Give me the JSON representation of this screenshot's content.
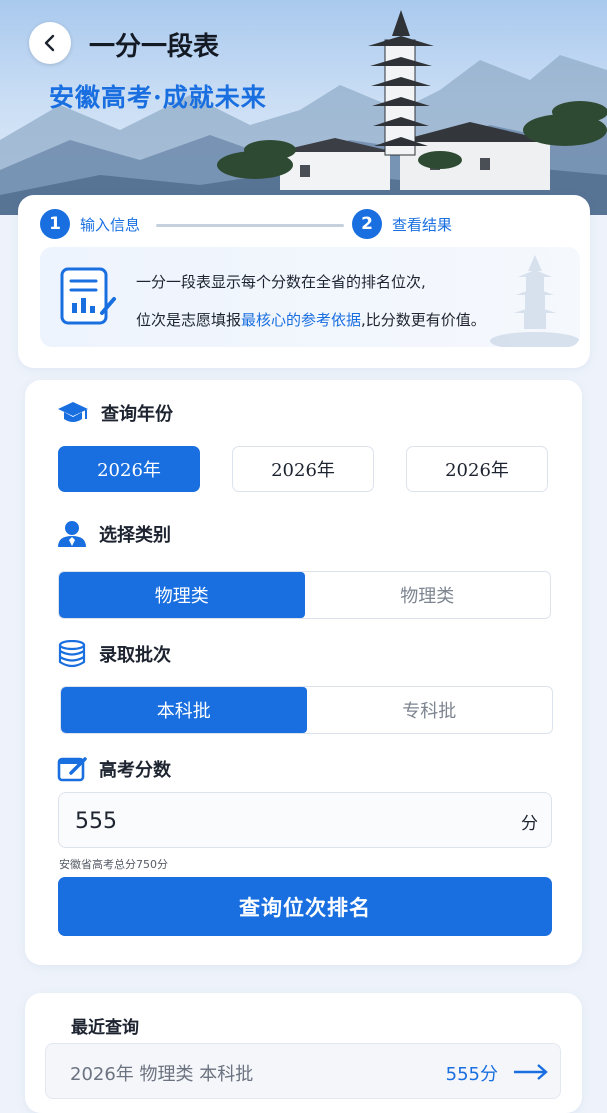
{
  "header": {
    "title": "一分一段表",
    "slogan": "安徽高考·成就未来"
  },
  "steps": [
    {
      "num": "1",
      "label": "输入信息"
    },
    {
      "num": "2",
      "label": "查看结果"
    }
  ],
  "info": {
    "line1": "一分一段表显示每个分数在全省的排名位次,",
    "line2_pre": "位次是志愿填报",
    "line2_highlight": "最核心的参考依据",
    "line2_post": ",比分数更有价值。"
  },
  "form": {
    "year_section": "查询年份",
    "year_options": [
      "2026年",
      "2026年",
      "2026年"
    ],
    "category_section": "选择类别",
    "category_options": [
      "物理类",
      "物理类"
    ],
    "batch_section": "录取批次",
    "batch_options": [
      "本科批",
      "专科批"
    ],
    "score_section": "高考分数",
    "score_value": "555",
    "score_unit": "分",
    "score_hint": "安徽省高考总分750分",
    "query_button": "查询位次排名"
  },
  "recent": {
    "title": "最近查询",
    "items": [
      {
        "desc": "2026年  物理类  本科批",
        "score": "555分"
      }
    ]
  },
  "colors": {
    "accent": "#1a6fe0",
    "background": "#eef3fb"
  }
}
